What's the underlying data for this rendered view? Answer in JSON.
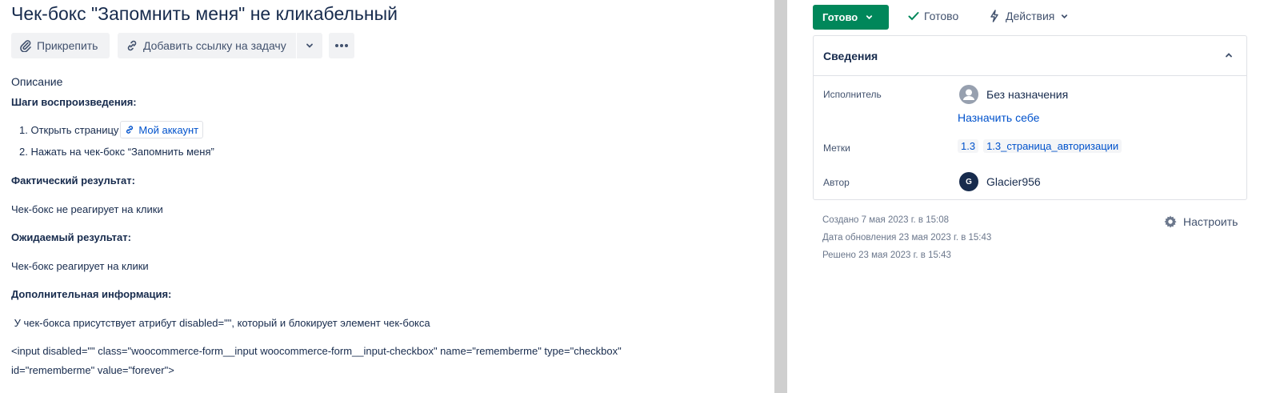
{
  "issue": {
    "title": "Чек-бокс \"Запомнить меня\" не кликабельный"
  },
  "toolbar": {
    "attach_label": "Прикрепить",
    "link_issue_label": "Добавить ссылку на задачу"
  },
  "description": {
    "label": "Описание",
    "steps_heading": "Шаги воспроизведения:",
    "step1_prefix": "1. Открыть страницу",
    "step1_link": "Мой аккаунт",
    "step2": "2. Нажать на чек-бокс “Запомнить меня”",
    "actual_heading": "Фактический результат:",
    "actual_text": "Чек-бокс не реагирует на клики",
    "expected_heading": "Ожидаемый результат:",
    "expected_text": "Чек-бокс реагирует на клики",
    "extra_heading": "Дополнительная информация:",
    "extra_text": " У чек-бокса присутствует атрибут disabled=\"\", который и блокирует элемент чек-бокса",
    "code_line1": "<input disabled=\"\" class=\"woocommerce-form__input woocommerce-form__input-checkbox\" name=\"rememberme\" type=\"checkbox\"",
    "code_line2": "id=\"rememberme\" value=\"forever\">"
  },
  "sidebar": {
    "status_label": "Готово",
    "done_transition": "Готово",
    "actions_label": "Действия",
    "details": {
      "title": "Сведения",
      "assignee_label": "Исполнитель",
      "assignee_value": "Без назначения",
      "assign_self": "Назначить себе",
      "labels_label": "Метки",
      "labels": [
        "1.3",
        "1.3_страница_авторизации"
      ],
      "author_label": "Автор",
      "author_initial": "G",
      "author_name": "Glacier956"
    },
    "created": "Создано 7 мая 2023 г. в 15:08",
    "updated": "Дата обновления 23 мая 2023 г. в 15:43",
    "resolved": "Решено 23 мая 2023 г. в 15:43",
    "configure_label": "Настроить"
  },
  "colors": {
    "status_green": "#00875a",
    "link_blue": "#0052cc",
    "divider_gray": "#cfcfcf"
  },
  "icons": [
    "paperclip-icon",
    "link-icon",
    "chevron-down-icon",
    "more-icon",
    "check-icon",
    "lightning-icon",
    "chevron-up-icon",
    "avatar-placeholder-icon",
    "gear-icon"
  ]
}
